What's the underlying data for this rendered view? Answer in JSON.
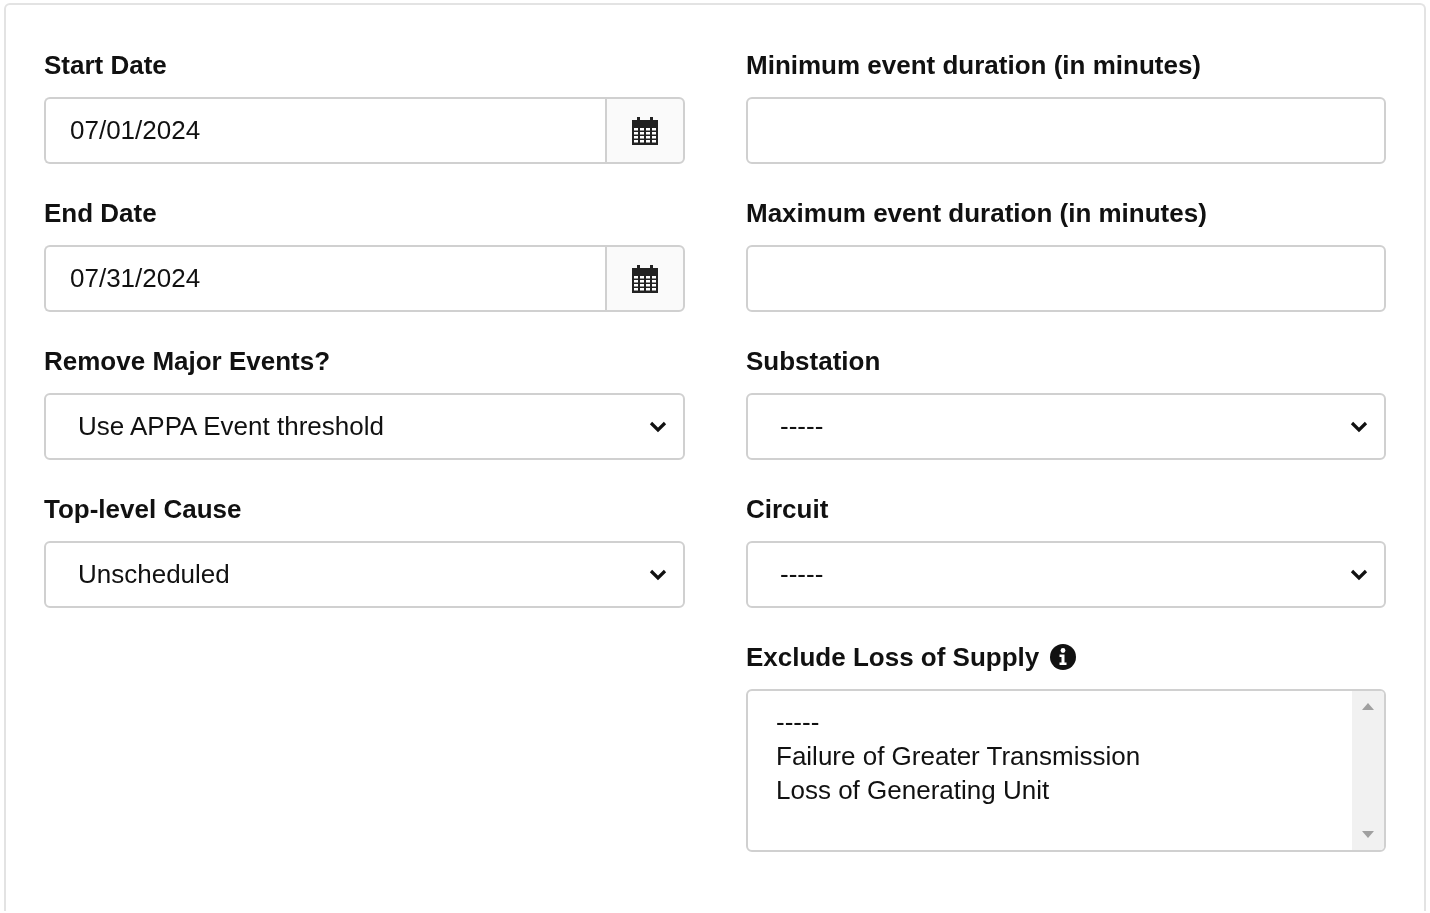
{
  "columns": [
    {
      "fields": [
        {
          "kind": "date",
          "label": "Start Date",
          "value": "07/01/2024"
        },
        {
          "kind": "date",
          "label": "End Date",
          "value": "07/31/2024"
        },
        {
          "kind": "select",
          "label": "Remove Major Events?",
          "value": "Use APPA Event threshold"
        },
        {
          "kind": "select",
          "label": "Top-level Cause",
          "value": "Unscheduled"
        }
      ]
    },
    {
      "fields": [
        {
          "kind": "text",
          "label": "Minimum event duration (in minutes)"
        },
        {
          "kind": "text",
          "label": "Maximum event duration (in minutes)"
        },
        {
          "kind": "select",
          "label": "Substation",
          "value": "-----"
        },
        {
          "kind": "select",
          "label": "Circuit",
          "value": "-----"
        },
        {
          "kind": "listbox",
          "label": "Exclude Loss of Supply",
          "info": true,
          "options": [
            {
              "label": "-----",
              "selected": false
            },
            {
              "label": "Failure of Greater Transmission",
              "selected": false
            },
            {
              "label": "Loss of Generating Unit",
              "selected": false
            }
          ]
        }
      ]
    }
  ]
}
